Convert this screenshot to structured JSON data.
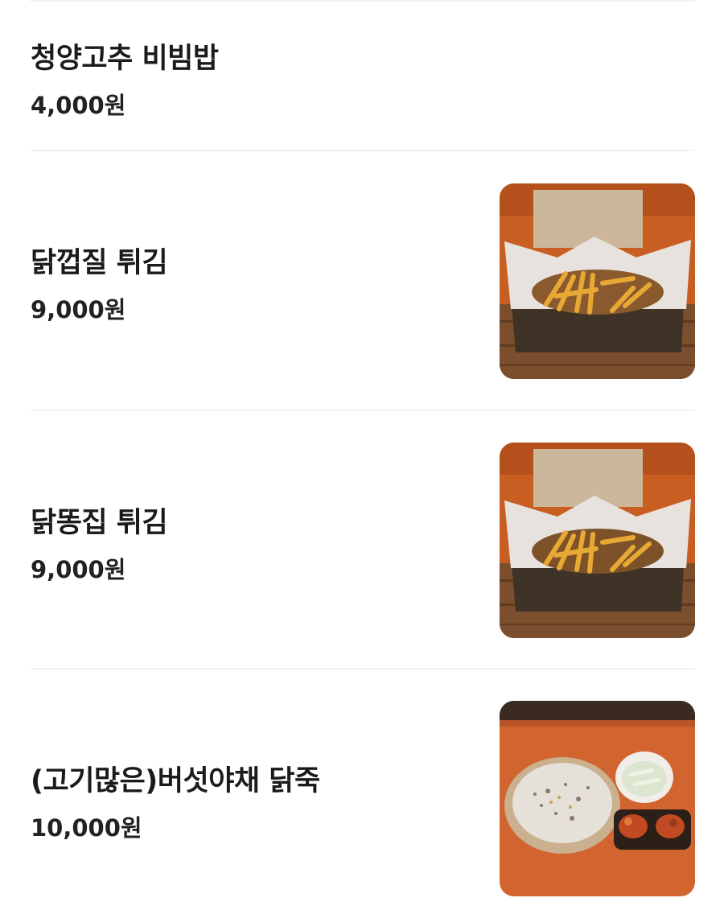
{
  "menu": {
    "items": [
      {
        "name": "청양고추 비빔밥",
        "price": "4,000원",
        "image": "none"
      },
      {
        "name": "닭껍질 튀김",
        "price": "9,000원",
        "image": "fried-chicken-skin-box-photo"
      },
      {
        "name": "닭똥집 튀김",
        "price": "9,000원",
        "image": "fried-gizzard-box-photo"
      },
      {
        "name": "(고기많은)버섯야채 닭죽",
        "price": "10,000원",
        "image": "chicken-porridge-bowl-photo"
      }
    ]
  },
  "colors": {
    "text": "#1b1b1b",
    "divider": "#f1f1f1",
    "background": "#ffffff"
  }
}
